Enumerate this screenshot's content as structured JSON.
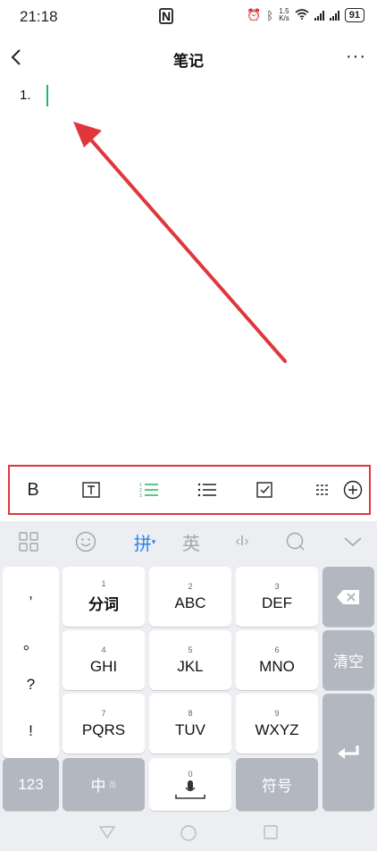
{
  "status_bar": {
    "time": "21:18",
    "nfc": "N",
    "speed_top": "1.5",
    "speed_bottom": "K/s",
    "battery": "91"
  },
  "header": {
    "title": "笔记",
    "more": "···"
  },
  "editor": {
    "list_marker": "1."
  },
  "toolbar": {
    "bold": "B"
  },
  "keyboard": {
    "pinyin_label": "拼",
    "english_label": "英",
    "punct": [
      ",",
      "。",
      "?",
      "!"
    ],
    "keys": [
      {
        "num": "1",
        "label": "分词"
      },
      {
        "num": "2",
        "label": "ABC"
      },
      {
        "num": "3",
        "label": "DEF"
      },
      {
        "num": "4",
        "label": "GHI"
      },
      {
        "num": "5",
        "label": "JKL"
      },
      {
        "num": "6",
        "label": "MNO"
      },
      {
        "num": "7",
        "label": "PQRS"
      },
      {
        "num": "8",
        "label": "TUV"
      },
      {
        "num": "9",
        "label": "WXYZ"
      }
    ],
    "clear_label": "清空",
    "num_mode": "123",
    "zh_mode": "中",
    "zh_sub": "英",
    "space_num": "0",
    "symbols": "符号"
  },
  "colors": {
    "accent_green": "#1fb85f",
    "highlight_red": "#e0373d",
    "keyboard_blue": "#2c82f0"
  }
}
